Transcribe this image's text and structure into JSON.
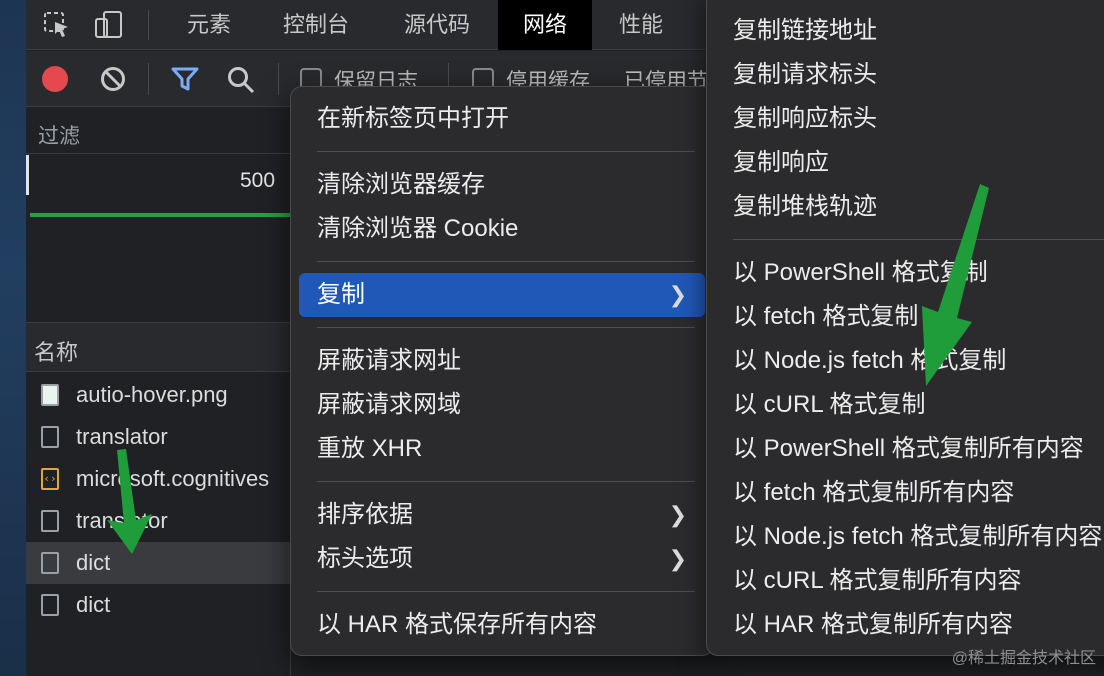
{
  "tabs": [
    {
      "label": "元素",
      "active": false
    },
    {
      "label": "控制台",
      "active": false
    },
    {
      "label": "源代码",
      "active": false
    },
    {
      "label": "网络",
      "active": true
    },
    {
      "label": "性能",
      "active": false
    }
  ],
  "toolbar": {
    "preserve_log_label": "保留日志",
    "disable_cache_label": "停用缓存",
    "throttle_label": "已停用节"
  },
  "filter_label": "过滤",
  "timeline": {
    "tick": "500"
  },
  "name_column_header": "名称",
  "requests": [
    {
      "name": "autio-hover.png",
      "icon": "image-icon"
    },
    {
      "name": "translator",
      "icon": "document-icon"
    },
    {
      "name": "microsoft.cognitives",
      "icon": "script-icon"
    },
    {
      "name": "translator",
      "icon": "document-icon"
    },
    {
      "name": "dict",
      "icon": "document-icon",
      "selected": true
    },
    {
      "name": "dict",
      "icon": "document-icon"
    }
  ],
  "context_menu": {
    "items": [
      "在新标签页中打开",
      "清除浏览器缓存",
      "清除浏览器 Cookie",
      "复制",
      "屏蔽请求网址",
      "屏蔽请求网域",
      "重放 XHR",
      "排序依据",
      "标头选项",
      "以 HAR 格式保存所有内容"
    ],
    "highlighted": "复制"
  },
  "copy_submenu": {
    "items": [
      "复制链接地址",
      "复制请求标头",
      "复制响应标头",
      "复制响应",
      "复制堆栈轨迹",
      "以 PowerShell 格式复制",
      "以 fetch 格式复制",
      "以 Node.js fetch 格式复制",
      "以 cURL 格式复制",
      "以 PowerShell 格式复制所有内容",
      "以 fetch 格式复制所有内容",
      "以 Node.js fetch 格式复制所有内容",
      "以 cURL 格式复制所有内容",
      "以 HAR 格式复制所有内容"
    ]
  },
  "watermark": "@稀土掘金技术社区",
  "colors": {
    "record": "#e5484d",
    "filter_active": "#7cacf8",
    "highlight": "#2058b8",
    "annotation_arrow": "#1f9d3a"
  }
}
